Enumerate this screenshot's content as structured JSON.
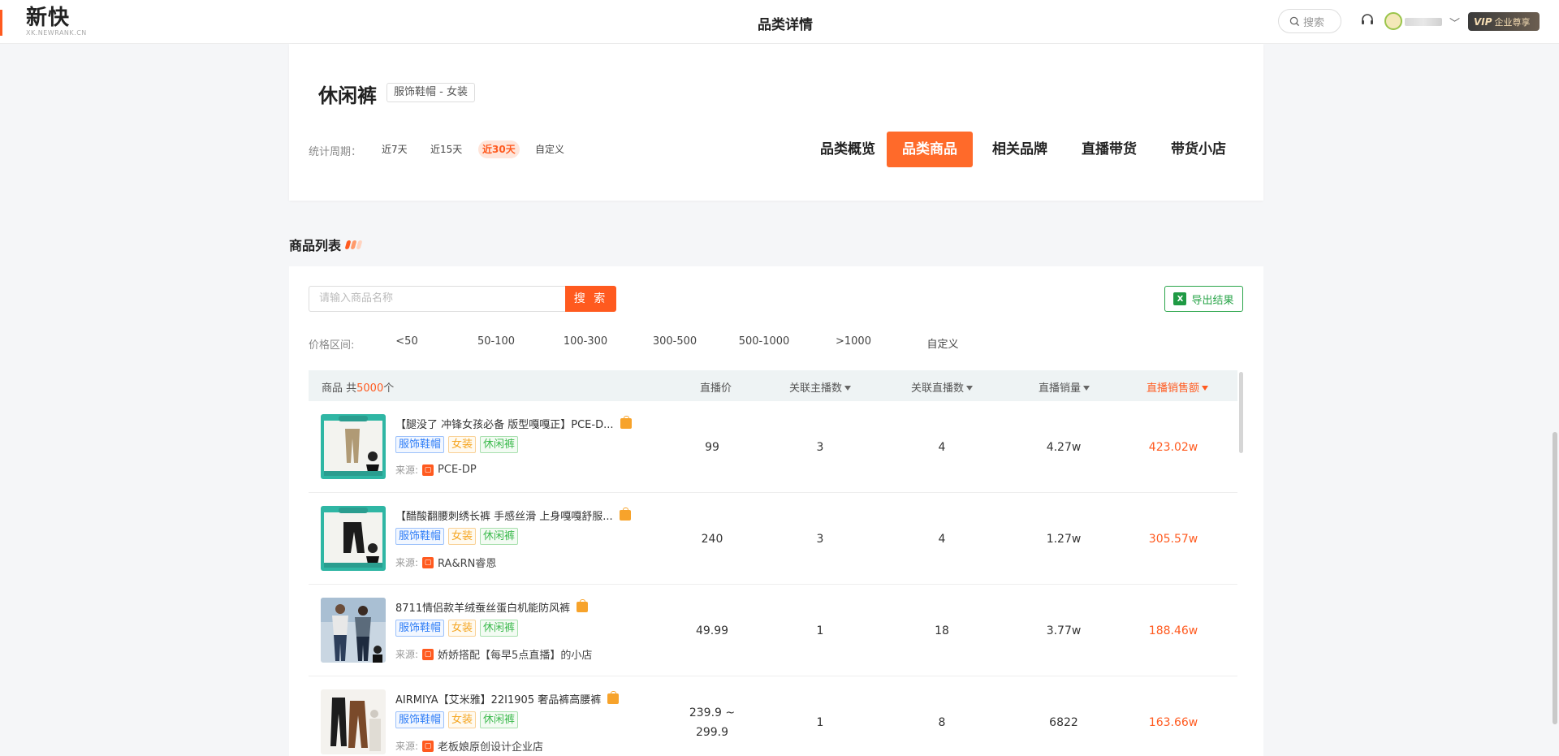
{
  "app": {
    "logo_cn": "新快",
    "logo_en": "XK.NEWRANK.CN",
    "page_title": "品类详情",
    "search_label": "搜索",
    "vip_prefix": "VIP",
    "vip_label": "企业尊享",
    "accent_color": "#ff5a1f"
  },
  "category": {
    "name": "休闲裤",
    "tag": "服饰鞋帽 - 女装",
    "period_label": "统计周期：",
    "periods": [
      "近7天",
      "近15天",
      "近30天",
      "自定义"
    ],
    "active_period": "近30天",
    "tabs": [
      "品类概览",
      "品类商品",
      "相关品牌",
      "直播带货",
      "带货小店"
    ],
    "active_tab": "品类商品"
  },
  "product_list": {
    "section_title": "商品列表",
    "search_placeholder": "请输入商品名称",
    "search_button": "搜 索",
    "export_label": "导出结果",
    "price_label": "价格区间:",
    "price_options": [
      "<50",
      "50-100",
      "100-300",
      "300-500",
      "500-1000",
      ">1000",
      "自定义"
    ],
    "columns": {
      "product_prefix": "商品  共",
      "total": "5000",
      "product_suffix": "个",
      "price": "直播价",
      "anchors": "关联主播数",
      "lives": "关联直播数",
      "sales": "直播销量",
      "revenue": "直播销售额"
    },
    "source_label": "来源:",
    "rows": [
      {
        "name": "【腿没了 冲锋女孩必备 版型嘎嘎正】PCE-D...",
        "tags": [
          "服饰鞋帽",
          "女装",
          "休闲裤"
        ],
        "source": "PCE-DP",
        "price": "99",
        "anchors": "3",
        "lives": "4",
        "sales": "4.27w",
        "revenue": "423.02w"
      },
      {
        "name": "【醋酸翻腰刺绣长裤 手感丝滑 上身嘎嘎舒服...",
        "tags": [
          "服饰鞋帽",
          "女装",
          "休闲裤"
        ],
        "source": "RA&RN睿恩",
        "price": "240",
        "anchors": "3",
        "lives": "4",
        "sales": "1.27w",
        "revenue": "305.57w"
      },
      {
        "name": "8711情侣款羊绒蚕丝蛋白机能防风裤",
        "tags": [
          "服饰鞋帽",
          "女装",
          "休闲裤"
        ],
        "source": "娇娇搭配【每早5点直播】的小店",
        "price": "49.99",
        "anchors": "1",
        "lives": "18",
        "sales": "3.77w",
        "revenue": "188.46w"
      },
      {
        "name": "AIRMIYA【艾米雅】22I1905 奢品裤高腰裤",
        "tags": [
          "服饰鞋帽",
          "女装",
          "休闲裤"
        ],
        "source": "老板娘原创设计企业店",
        "price": "239.9 ~\n299.9",
        "price_line1": "239.9 ~",
        "price_line2": "299.9",
        "anchors": "1",
        "lives": "8",
        "sales": "6822",
        "revenue": "163.66w"
      }
    ]
  }
}
